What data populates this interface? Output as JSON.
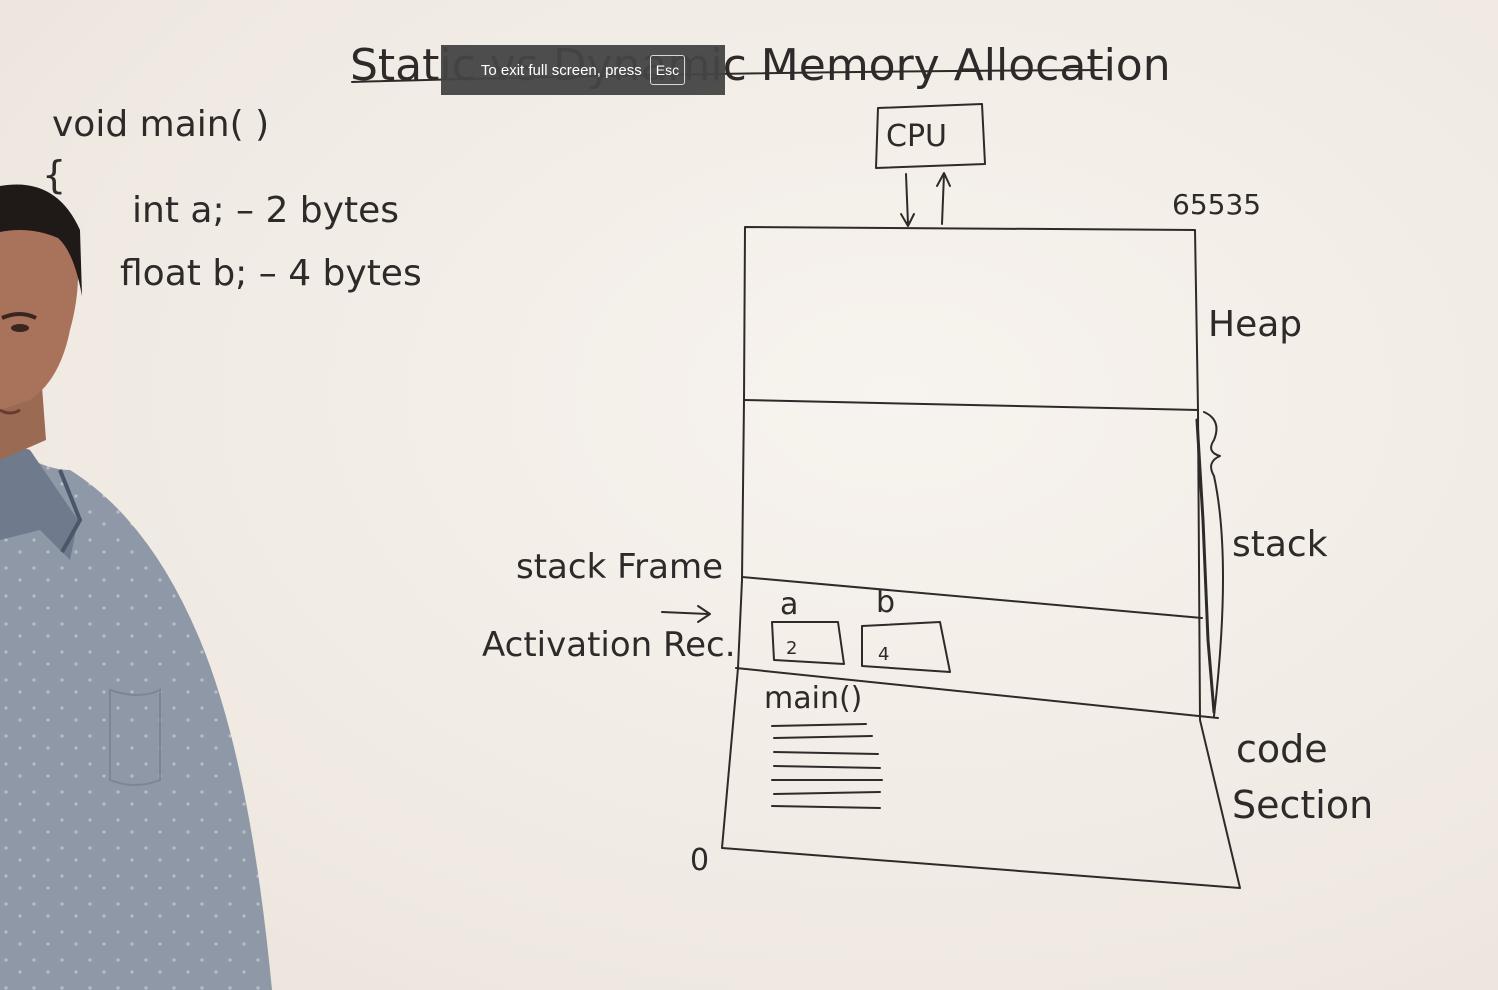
{
  "board": {
    "title": "Static vs Dynamic Memory Allocation",
    "code": {
      "signature": "void main( )",
      "brace": "{",
      "line1": "int a; – 2 bytes",
      "line2": "float b; – 4 bytes"
    },
    "cpu": "CPU",
    "top_address": "65535",
    "bottom_address": "0",
    "sections": {
      "heap": "Heap",
      "stack": "stack",
      "code_line1": "code",
      "code_line2": "Section"
    },
    "stack_frame_label": "stack Frame",
    "activation_label": "Activation Rec.",
    "variables": [
      {
        "name": "a",
        "value": "2"
      },
      {
        "name": "b",
        "value": "4"
      }
    ],
    "function_label": "main()"
  },
  "fullscreen_notice": {
    "text": "To exit full screen, press",
    "key": "Esc"
  },
  "colors": {
    "whiteboard": "#f3efe9",
    "ink": "#2f2a2a",
    "notice_bg": "#444444",
    "shirt": "#8e98a6"
  },
  "icons": {
    "presenter": "person-illustration"
  }
}
